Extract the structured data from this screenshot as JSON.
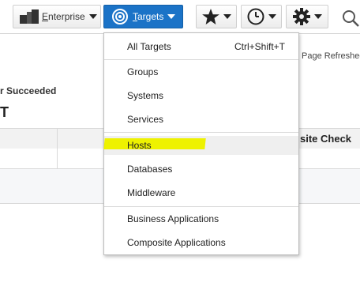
{
  "topbar": {
    "enterprise": {
      "first_letter": "E",
      "rest": "nterprise"
    },
    "targets": {
      "first_letter": "T",
      "rest": "argets"
    }
  },
  "page": {
    "refreshed": "Page Refreshed",
    "succeeded": "r Succeeded",
    "heading": "T",
    "site_check": "site Check"
  },
  "menu": {
    "items": [
      {
        "label": "All Targets",
        "shortcut": "Ctrl+Shift+T"
      },
      {
        "label": "Groups"
      },
      {
        "label": "Systems"
      },
      {
        "label": "Services"
      },
      {
        "label": "Hosts"
      },
      {
        "label": "Databases"
      },
      {
        "label": "Middleware"
      },
      {
        "label": "Business Applications"
      },
      {
        "label": "Composite Applications"
      }
    ]
  },
  "colors": {
    "targets_button": "#1b73c7",
    "highlight": "#eef200"
  },
  "icons": {
    "enterprise": "enterprise-icon",
    "targets": "target-icon",
    "favorites": "star-icon",
    "history": "clock-icon",
    "setup": "gear-icon",
    "search": "search-icon"
  }
}
